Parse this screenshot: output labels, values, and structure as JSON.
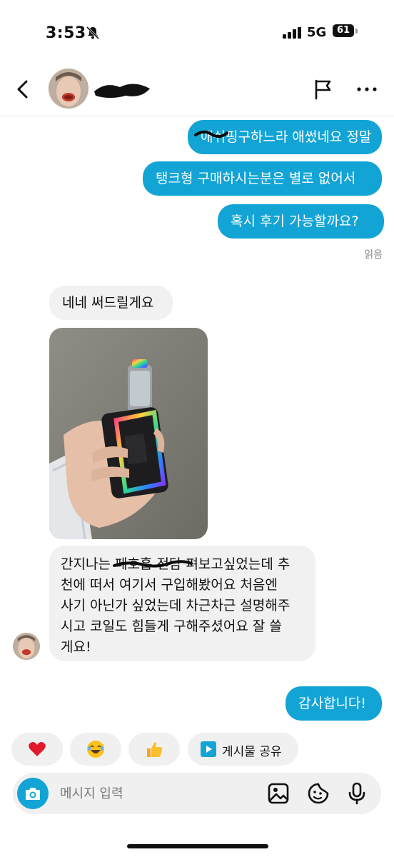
{
  "status_bar": {
    "time": "3:53",
    "network": "5G",
    "battery": "61"
  },
  "header": {
    "flag_label": "Report",
    "more_label": "More"
  },
  "messages": {
    "out1": "애쉬핑구하느라 애썼네요 정말",
    "out2": "탱크형 구매하시는분은 별로 없어서",
    "out3": "혹시 후기 가능할까요?",
    "read_receipt": "읽음",
    "in1": "네네 써드릴게요",
    "in2_lines": [
      "간지나는 페호흡 전담 펴보고싶었는데 추",
      "천에 떠서 여기서 구입해봤어요 처음엔",
      "사기 아닌가 싶었는데 차근차근 설명해주",
      "시고 코일도 힘들게 구해주셨어요 잘 쓸",
      "게요!"
    ],
    "out4": "감사합니다!"
  },
  "quick_replies": {
    "share_post": "게시물 공유"
  },
  "composer": {
    "placeholder": "메시지 입력"
  },
  "colors": {
    "accent": "#13a4d6",
    "incoming_bubble": "#f1f1f1",
    "heart": "#e0192c"
  },
  "icons": [
    "bell-slash-icon",
    "signal-icon",
    "back-icon",
    "flag-icon",
    "more-icon",
    "heart-icon",
    "laugh-emoji-icon",
    "thumbs-up-icon",
    "play-icon",
    "camera-icon",
    "image-icon",
    "sticker-icon",
    "mic-icon"
  ]
}
